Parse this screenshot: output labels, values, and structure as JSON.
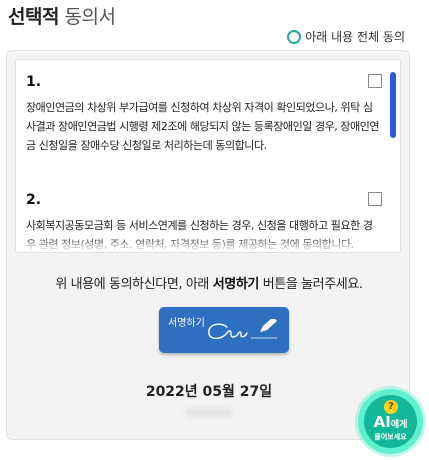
{
  "header": {
    "title_bold": "선택적",
    "title_rest": "동의서",
    "agree_all_label": "아래 내용 전체 동의"
  },
  "terms": [
    {
      "number": "1.",
      "text": "장애인연금의 차상위 부가급여를 신청하여 차상위 자격이 확인되었으나, 위탁 심사결과 장애인연금법 시행령 제2조에 해당되지 않는 등록장애인일 경우, 장애인연금 신청일을 장애수당 신청일로 처리하는데 동의합니다.",
      "checked": false
    },
    {
      "number": "2.",
      "text": "사회복지공동모금회 등 서비스연계를 신청하는 경우, 신청을 대행하고 필요한 경우 관련 정보(성명, 주소, 연락처, 자격정보 등)를 제공하는 것에 동의합니다.",
      "checked": false
    }
  ],
  "instruction": {
    "before": "위 내용에 동의하신다면, 아래 ",
    "highlight": "서명하기",
    "after": " 버튼을 눌러주세요."
  },
  "sign_button": {
    "label": "서명하기",
    "icon": "signature-pen-icon"
  },
  "date": "2022년 05월 27일",
  "ai_assistant": {
    "badge": "?",
    "title_strong": "AI",
    "title_small": "에게",
    "subtitle": "물어보세요"
  },
  "colors": {
    "accent_teal": "#2aa79b",
    "sign_button_blue": "#2f6fc0",
    "scrollbar_blue": "#2d5bd8",
    "ai_green": "#14b79a"
  }
}
